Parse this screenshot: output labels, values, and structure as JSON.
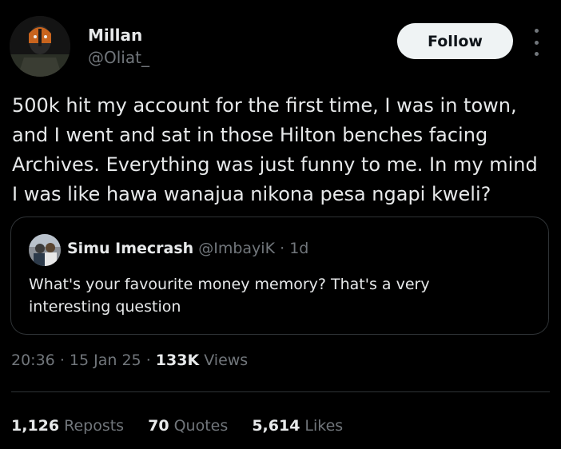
{
  "author": {
    "name": "Millan",
    "handle": "@Oliat_"
  },
  "actions": {
    "follow_label": "Follow"
  },
  "tweet": {
    "lines": [
      "500k hit my account for the first time, I was in town,",
      "and I went and sat in those Hilton benches facing",
      "Archives. Everything was just funny to me. In my mind",
      "I was like hawa wanajua nikona pesa ngapi kweli?"
    ]
  },
  "quote": {
    "name": "Simu Imecrash",
    "handle": "@ImbayiK",
    "separator": "·",
    "time": "1d",
    "lines": [
      "What's your favourite money memory? That's a very",
      "interesting question"
    ]
  },
  "meta": {
    "time": "20:36",
    "separator": "·",
    "date": "15 Jan 25",
    "views_count": "133K",
    "views_label": "Views"
  },
  "stats": {
    "reposts_count": "1,126",
    "reposts_label": "Reposts",
    "quotes_count": "70",
    "quotes_label": "Quotes",
    "likes_count": "5,614",
    "likes_label": "Likes"
  }
}
